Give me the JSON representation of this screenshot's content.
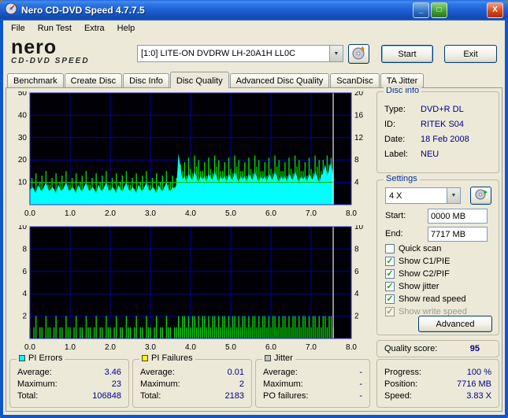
{
  "window": {
    "title": "Nero CD-DVD Speed 4.7.7.5"
  },
  "icons": {
    "check": "✓",
    "dropdown_arrow": "▼",
    "close": "X",
    "minimize": "_",
    "maximize": "□"
  },
  "menu": {
    "items": [
      "File",
      "Run Test",
      "Extra",
      "Help"
    ]
  },
  "header": {
    "logo_line1": "nero",
    "logo_line2": "CD-DVD SPEED",
    "drive_select": "[1:0]  LITE-ON DVDRW LH-20A1H LL0C",
    "start_button": "Start",
    "exit_button": "Exit"
  },
  "tabs": {
    "items": [
      "Benchmark",
      "Create Disc",
      "Disc Info",
      "Disc Quality",
      "Advanced Disc Quality",
      "ScanDisc",
      "TA Jitter"
    ],
    "active": "Disc Quality"
  },
  "disc_info": {
    "title": "Disc info",
    "rows": [
      {
        "label": "Type:",
        "value": "DVD+R DL"
      },
      {
        "label": "ID:",
        "value": "RITEK S04"
      },
      {
        "label": "Date:",
        "value": "18 Feb 2008"
      },
      {
        "label": "Label:",
        "value": "NEU"
      }
    ]
  },
  "settings": {
    "title": "Settings",
    "speed": "4 X",
    "start_label": "Start:",
    "start_value": "0000 MB",
    "end_label": "End:",
    "end_value": "7717 MB",
    "checkboxes": [
      {
        "label": "Quick scan",
        "checked": false,
        "disabled": false
      },
      {
        "label": "Show C1/PIE",
        "checked": true,
        "disabled": false
      },
      {
        "label": "Show C2/PIF",
        "checked": true,
        "disabled": false
      },
      {
        "label": "Show jitter",
        "checked": true,
        "disabled": false
      },
      {
        "label": "Show read speed",
        "checked": true,
        "disabled": false
      },
      {
        "label": "Show write speed",
        "checked": true,
        "disabled": true
      }
    ],
    "advanced_button": "Advanced"
  },
  "quality": {
    "label": "Quality score:",
    "value": "95"
  },
  "progress": {
    "rows": [
      {
        "label": "Progress:",
        "value": "100 %"
      },
      {
        "label": "Position:",
        "value": "7716 MB"
      },
      {
        "label": "Speed:",
        "value": "3.83 X"
      }
    ]
  },
  "stats": {
    "pi_errors": {
      "title": "PI Errors",
      "swatch": "#00FFFF",
      "rows": [
        {
          "label": "Average:",
          "value": "3.46"
        },
        {
          "label": "Maximum:",
          "value": "23"
        },
        {
          "label": "Total:",
          "value": "106848"
        }
      ]
    },
    "pi_failures": {
      "title": "PI Failures",
      "swatch": "#FFFF00",
      "rows": [
        {
          "label": "Average:",
          "value": "0.01"
        },
        {
          "label": "Maximum:",
          "value": "2"
        },
        {
          "label": "Total:",
          "value": "2183"
        }
      ]
    },
    "jitter": {
      "title": "Jitter",
      "swatch": "#C0C0C0",
      "rows": [
        {
          "label": "Average:",
          "value": "-"
        },
        {
          "label": "Maximum:",
          "value": "-"
        },
        {
          "label": "PO failures:",
          "value": "-"
        }
      ]
    }
  },
  "chart_data": [
    {
      "type": "area",
      "description": "PI Errors (C1/PIE, cyan area) with green jitter spikes and flat 4X read-speed line; scan ends at 7.55 GB",
      "x_step": 0.05,
      "xlim": [
        0,
        8
      ],
      "x_ticks": [
        "0.0",
        "1.0",
        "2.0",
        "3.0",
        "4.0",
        "5.0",
        "6.0",
        "7.0",
        "8.0"
      ],
      "ylim_left": [
        0,
        50
      ],
      "yticks_left": [
        10,
        20,
        30,
        40,
        50
      ],
      "ylim_right": [
        0,
        20
      ],
      "yticks_right": [
        4,
        8,
        12,
        16,
        20
      ],
      "cursor_x": 7.55,
      "series": [
        {
          "name": "jitter spikes",
          "style": "bars",
          "axis": "left",
          "color": "#00DC00",
          "values": [
            9,
            12,
            7,
            14,
            8,
            10,
            13,
            8,
            15,
            9,
            9,
            12,
            7,
            14,
            8,
            10,
            13,
            8,
            15,
            9,
            9,
            12,
            7,
            14,
            8,
            10,
            13,
            8,
            15,
            9,
            9,
            12,
            7,
            14,
            8,
            10,
            13,
            8,
            15,
            9,
            9,
            12,
            7,
            14,
            8,
            10,
            13,
            8,
            15,
            9,
            9,
            12,
            7,
            14,
            8,
            10,
            13,
            8,
            15,
            9,
            9,
            12,
            7,
            14,
            8,
            10,
            13,
            8,
            15,
            9,
            10,
            13,
            8,
            12,
            20,
            18,
            15,
            19,
            13,
            21,
            16,
            14,
            22,
            17,
            20,
            15,
            15,
            19,
            13,
            21,
            16,
            14,
            22,
            17,
            20,
            15,
            15,
            19,
            13,
            21,
            16,
            14,
            22,
            17,
            20,
            15,
            15,
            19,
            13,
            21,
            16,
            14,
            22,
            17,
            20,
            15,
            15,
            19,
            13,
            21,
            16,
            14,
            22,
            17,
            20,
            15,
            15,
            19,
            13,
            21,
            16,
            14,
            22,
            17,
            20,
            15,
            15,
            19,
            13,
            21,
            16,
            14,
            22,
            17,
            20,
            15,
            20,
            17,
            22,
            18,
            21,
            16
          ]
        },
        {
          "name": "PI Errors (PIE)",
          "style": "area",
          "axis": "left",
          "color": "#00FFFF",
          "values": [
            6,
            8,
            7,
            5,
            9,
            7,
            6,
            8,
            10,
            7,
            6,
            8,
            7,
            5,
            9,
            7,
            6,
            8,
            10,
            7,
            6,
            8,
            7,
            5,
            9,
            7,
            6,
            8,
            10,
            7,
            6,
            8,
            7,
            5,
            9,
            7,
            6,
            8,
            10,
            7,
            6,
            8,
            7,
            5,
            9,
            7,
            6,
            8,
            10,
            7,
            6,
            8,
            7,
            5,
            9,
            7,
            6,
            8,
            10,
            7,
            6,
            8,
            7,
            5,
            9,
            7,
            6,
            8,
            10,
            7,
            6,
            8,
            7,
            9,
            23,
            16,
            11,
            13,
            10,
            14,
            12,
            11,
            15,
            12,
            10,
            13,
            11,
            13,
            10,
            14,
            12,
            11,
            15,
            12,
            10,
            13,
            11,
            13,
            10,
            14,
            12,
            11,
            15,
            12,
            10,
            13,
            11,
            13,
            10,
            14,
            12,
            11,
            15,
            12,
            10,
            13,
            11,
            13,
            10,
            14,
            12,
            11,
            15,
            12,
            10,
            13,
            11,
            13,
            10,
            14,
            12,
            11,
            15,
            12,
            10,
            13,
            11,
            13,
            10,
            14,
            12,
            11,
            15,
            12,
            10,
            13,
            14,
            18,
            13,
            16,
            19,
            12
          ]
        },
        {
          "name": "read speed (X)",
          "style": "hline",
          "axis": "right",
          "color": "#00C800",
          "y": 4,
          "x_end": 7.55
        }
      ]
    },
    {
      "type": "bar",
      "description": "PI Failures (C2/PIF, green bars); scan ends at 7.55 GB",
      "x_step": 0.05,
      "xlim": [
        0,
        8
      ],
      "x_ticks": [
        "0.0",
        "1.0",
        "2.0",
        "3.0",
        "4.0",
        "5.0",
        "6.0",
        "7.0",
        "8.0"
      ],
      "ylim_left": [
        0,
        10
      ],
      "yticks_left": [
        2,
        4,
        6,
        8,
        10
      ],
      "ylim_right": [
        0,
        10
      ],
      "yticks_right": [
        2,
        4,
        6,
        8,
        10
      ],
      "cursor_x": 7.55,
      "series": [
        {
          "name": "PI Failures (PIF)",
          "style": "bars",
          "axis": "left",
          "color": "#00DC00",
          "values": [
            1,
            0,
            1,
            2,
            0,
            1,
            1,
            0,
            2,
            1,
            1,
            0,
            1,
            2,
            0,
            1,
            1,
            0,
            2,
            1,
            1,
            0,
            1,
            2,
            0,
            1,
            1,
            0,
            2,
            1,
            1,
            0,
            1,
            2,
            0,
            1,
            1,
            0,
            2,
            1,
            1,
            0,
            1,
            2,
            0,
            1,
            1,
            0,
            2,
            1,
            1,
            0,
            1,
            2,
            0,
            1,
            1,
            0,
            2,
            1,
            1,
            0,
            1,
            2,
            0,
            1,
            1,
            0,
            2,
            1,
            1,
            0,
            1,
            1,
            2,
            1,
            2,
            2,
            1,
            2,
            1,
            2,
            2,
            1,
            2,
            1,
            2,
            2,
            1,
            2,
            1,
            2,
            2,
            1,
            2,
            1,
            2,
            2,
            1,
            2,
            1,
            2,
            2,
            1,
            2,
            1,
            2,
            2,
            1,
            2,
            1,
            2,
            2,
            1,
            2,
            1,
            2,
            2,
            1,
            2,
            1,
            2,
            2,
            1,
            2,
            1,
            2,
            2,
            1,
            2,
            1,
            2,
            2,
            1,
            2,
            1,
            2,
            2,
            1,
            2,
            1,
            2,
            2,
            1,
            2,
            1,
            2,
            2,
            1,
            2,
            2,
            1
          ]
        }
      ]
    }
  ]
}
